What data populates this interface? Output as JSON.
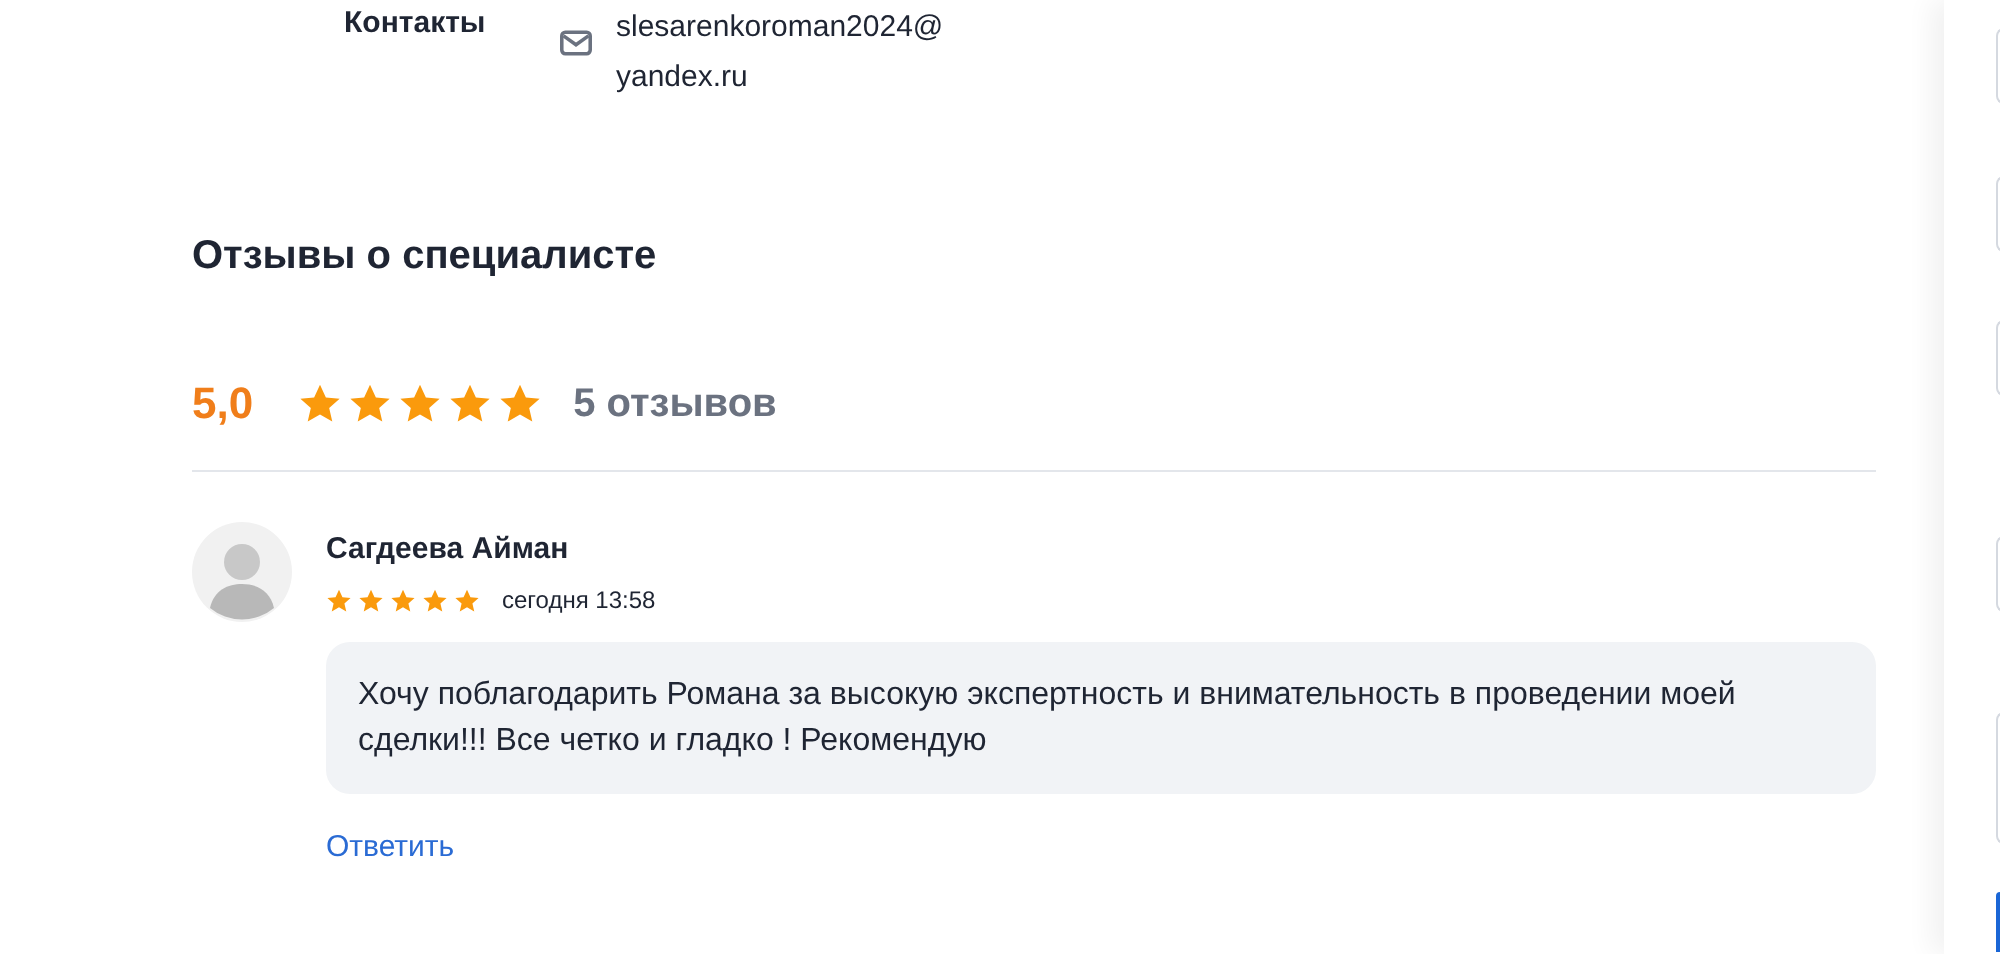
{
  "contacts": {
    "label": "Контакты",
    "email": "slesarenkoroman2024@yandex.ru"
  },
  "reviews_section": {
    "title": "Отзывы о специалисте",
    "rating": "5,0",
    "stars": 5,
    "count": "5 отзывов"
  },
  "reviews": [
    {
      "author": "Сагдеева Айман",
      "stars": 5,
      "time": "сегодня 13:58",
      "text": "Хочу поблагодарить Романа за высокую экспертность и внимательность в проведении моей сделки!!! Все четко и гладко ! Рекомендую",
      "reply": "Ответить"
    }
  ]
}
